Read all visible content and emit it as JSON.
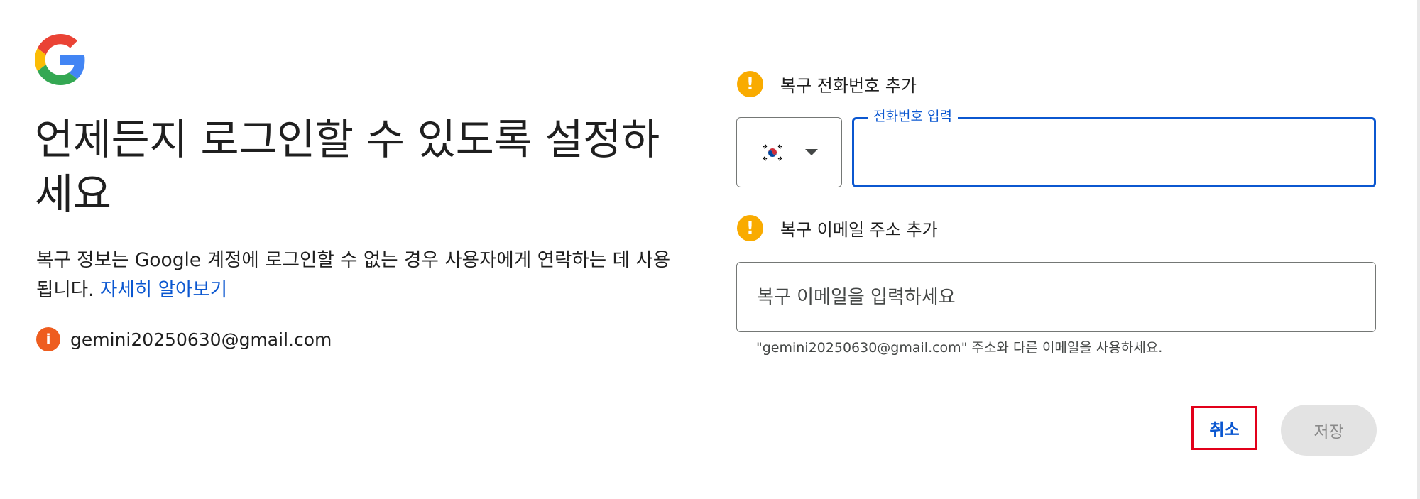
{
  "header": {
    "logo": "google-g-logo",
    "title": "언제든지 로그인할 수 있도록 설정하세요"
  },
  "description": {
    "text": "복구 정보는 Google 계정에 로그인할 수 없는 경우 사용자에게 연락하는 데 사용됩니다. ",
    "link_text": "자세히 알아보기"
  },
  "account": {
    "icon": "info-icon",
    "icon_glyph": "i",
    "email": "gemini20250630@gmail.com"
  },
  "phone_section": {
    "warning_glyph": "!",
    "label": "복구 전화번호 추가",
    "country_flag": "south-korea-flag",
    "field_label": "전화번호 입력",
    "value": ""
  },
  "email_section": {
    "warning_glyph": "!",
    "label": "복구 이메일 주소 추가",
    "placeholder": "복구 이메일을 입력하세요",
    "value": "",
    "helper": "\"gemini20250630@gmail.com\" 주소와 다른 이메일을 사용하세요."
  },
  "actions": {
    "cancel_label": "취소",
    "save_label": "저장"
  },
  "colors": {
    "accent": "#0b57d0",
    "warning": "#f9ab00",
    "info": "#ee5d1f",
    "highlight_border": "#e2001a",
    "disabled_bg": "#e3e3e3"
  }
}
